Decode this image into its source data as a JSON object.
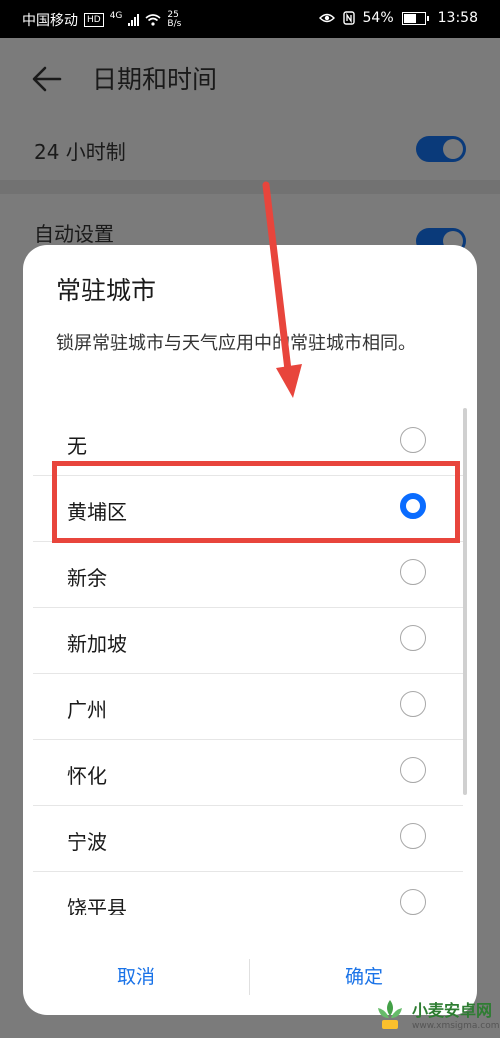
{
  "status_bar": {
    "carrier": "中国移动",
    "hd": "HD",
    "network": "4G",
    "speed_value": "25",
    "speed_unit": "B/s",
    "battery": "54%",
    "time": "13:58"
  },
  "settings_page": {
    "title": "日期和时间",
    "rows": [
      {
        "label": "24 小时制",
        "toggle_on": true
      },
      {
        "label": "自动设置",
        "toggle_on": true
      }
    ]
  },
  "dialog": {
    "title": "常驻城市",
    "description": "锁屏常驻城市与天气应用中的常驻城市相同。",
    "options": [
      {
        "label": "无",
        "selected": false
      },
      {
        "label": "黄埔区",
        "selected": true
      },
      {
        "label": "新余",
        "selected": false
      },
      {
        "label": "新加坡",
        "selected": false
      },
      {
        "label": "广州",
        "selected": false
      },
      {
        "label": "怀化",
        "selected": false
      },
      {
        "label": "宁波",
        "selected": false
      },
      {
        "label": "饶平县",
        "selected": false
      }
    ],
    "cancel_label": "取消",
    "ok_label": "确定"
  },
  "colors": {
    "accent": "#0a6cff",
    "annotation": "#e8453c"
  },
  "watermark": {
    "title": "小麦安卓网",
    "url": "www.xmsigma.com"
  }
}
